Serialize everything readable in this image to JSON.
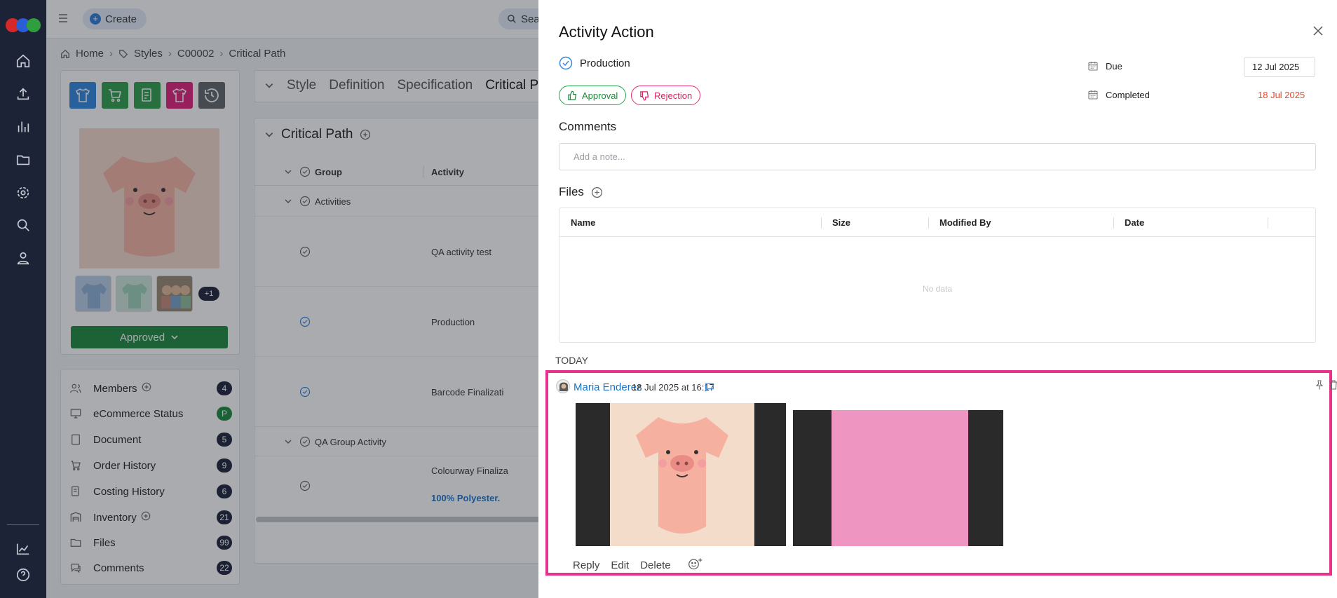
{
  "topbar": {
    "create_label": "Create",
    "search_label": "Sear"
  },
  "breadcrumb": [
    "Home",
    "Styles",
    "C00002",
    "Critical Path"
  ],
  "product": {
    "thumb_more": "+1",
    "status_label": "Approved"
  },
  "sidebar": {
    "items": [
      {
        "label": "Members",
        "count": "4",
        "addable": true
      },
      {
        "label": "eCommerce Status",
        "count": "P"
      },
      {
        "label": "Document",
        "count": "5"
      },
      {
        "label": "Order History",
        "count": "9"
      },
      {
        "label": "Costing History",
        "count": "6"
      },
      {
        "label": "Inventory",
        "count": "21",
        "addable": true
      },
      {
        "label": "Files",
        "count": "99"
      },
      {
        "label": "Comments",
        "count": "22"
      }
    ]
  },
  "style_tabs": [
    "Style",
    "Definition",
    "Specification",
    "Critical Pa"
  ],
  "critical_path": {
    "title": "Critical Path",
    "columns": {
      "group": "Group",
      "activity": "Activity"
    },
    "rows": [
      {
        "group": "Activities"
      },
      {
        "activity": "QA activity test"
      },
      {
        "activity": "Production"
      },
      {
        "activity": "Barcode Finalizati"
      },
      {
        "group": "QA Group Activity"
      },
      {
        "activity": "Colourway Finaliza",
        "sub": "100% Polyester."
      }
    ]
  },
  "drawer": {
    "title": "Activity Action",
    "activity_name": "Production",
    "approval_label": "Approval",
    "rejection_label": "Rejection",
    "due_label": "Due",
    "due_value": "12 Jul 2025",
    "completed_label": "Completed",
    "completed_value": "18 Jul 2025",
    "comments_label": "Comments",
    "note_placeholder": "Add a note...",
    "files_label": "Files",
    "files_columns": {
      "name": "Name",
      "size": "Size",
      "modified_by": "Modified By",
      "date": "Date"
    },
    "files_empty": "No data",
    "day_label": "TODAY",
    "comment": {
      "author": "Maria Enderez",
      "timestamp": "18 Jul 2025 at 16:17",
      "actions": {
        "reply": "Reply",
        "edit": "Edit",
        "delete": "Delete"
      }
    }
  },
  "colors": {
    "nav_bg": "#1c2337",
    "green": "#1e8a3c",
    "highlight_border": "#e8318a",
    "link_blue": "#1a73c9",
    "completed_red": "#e8492a"
  }
}
